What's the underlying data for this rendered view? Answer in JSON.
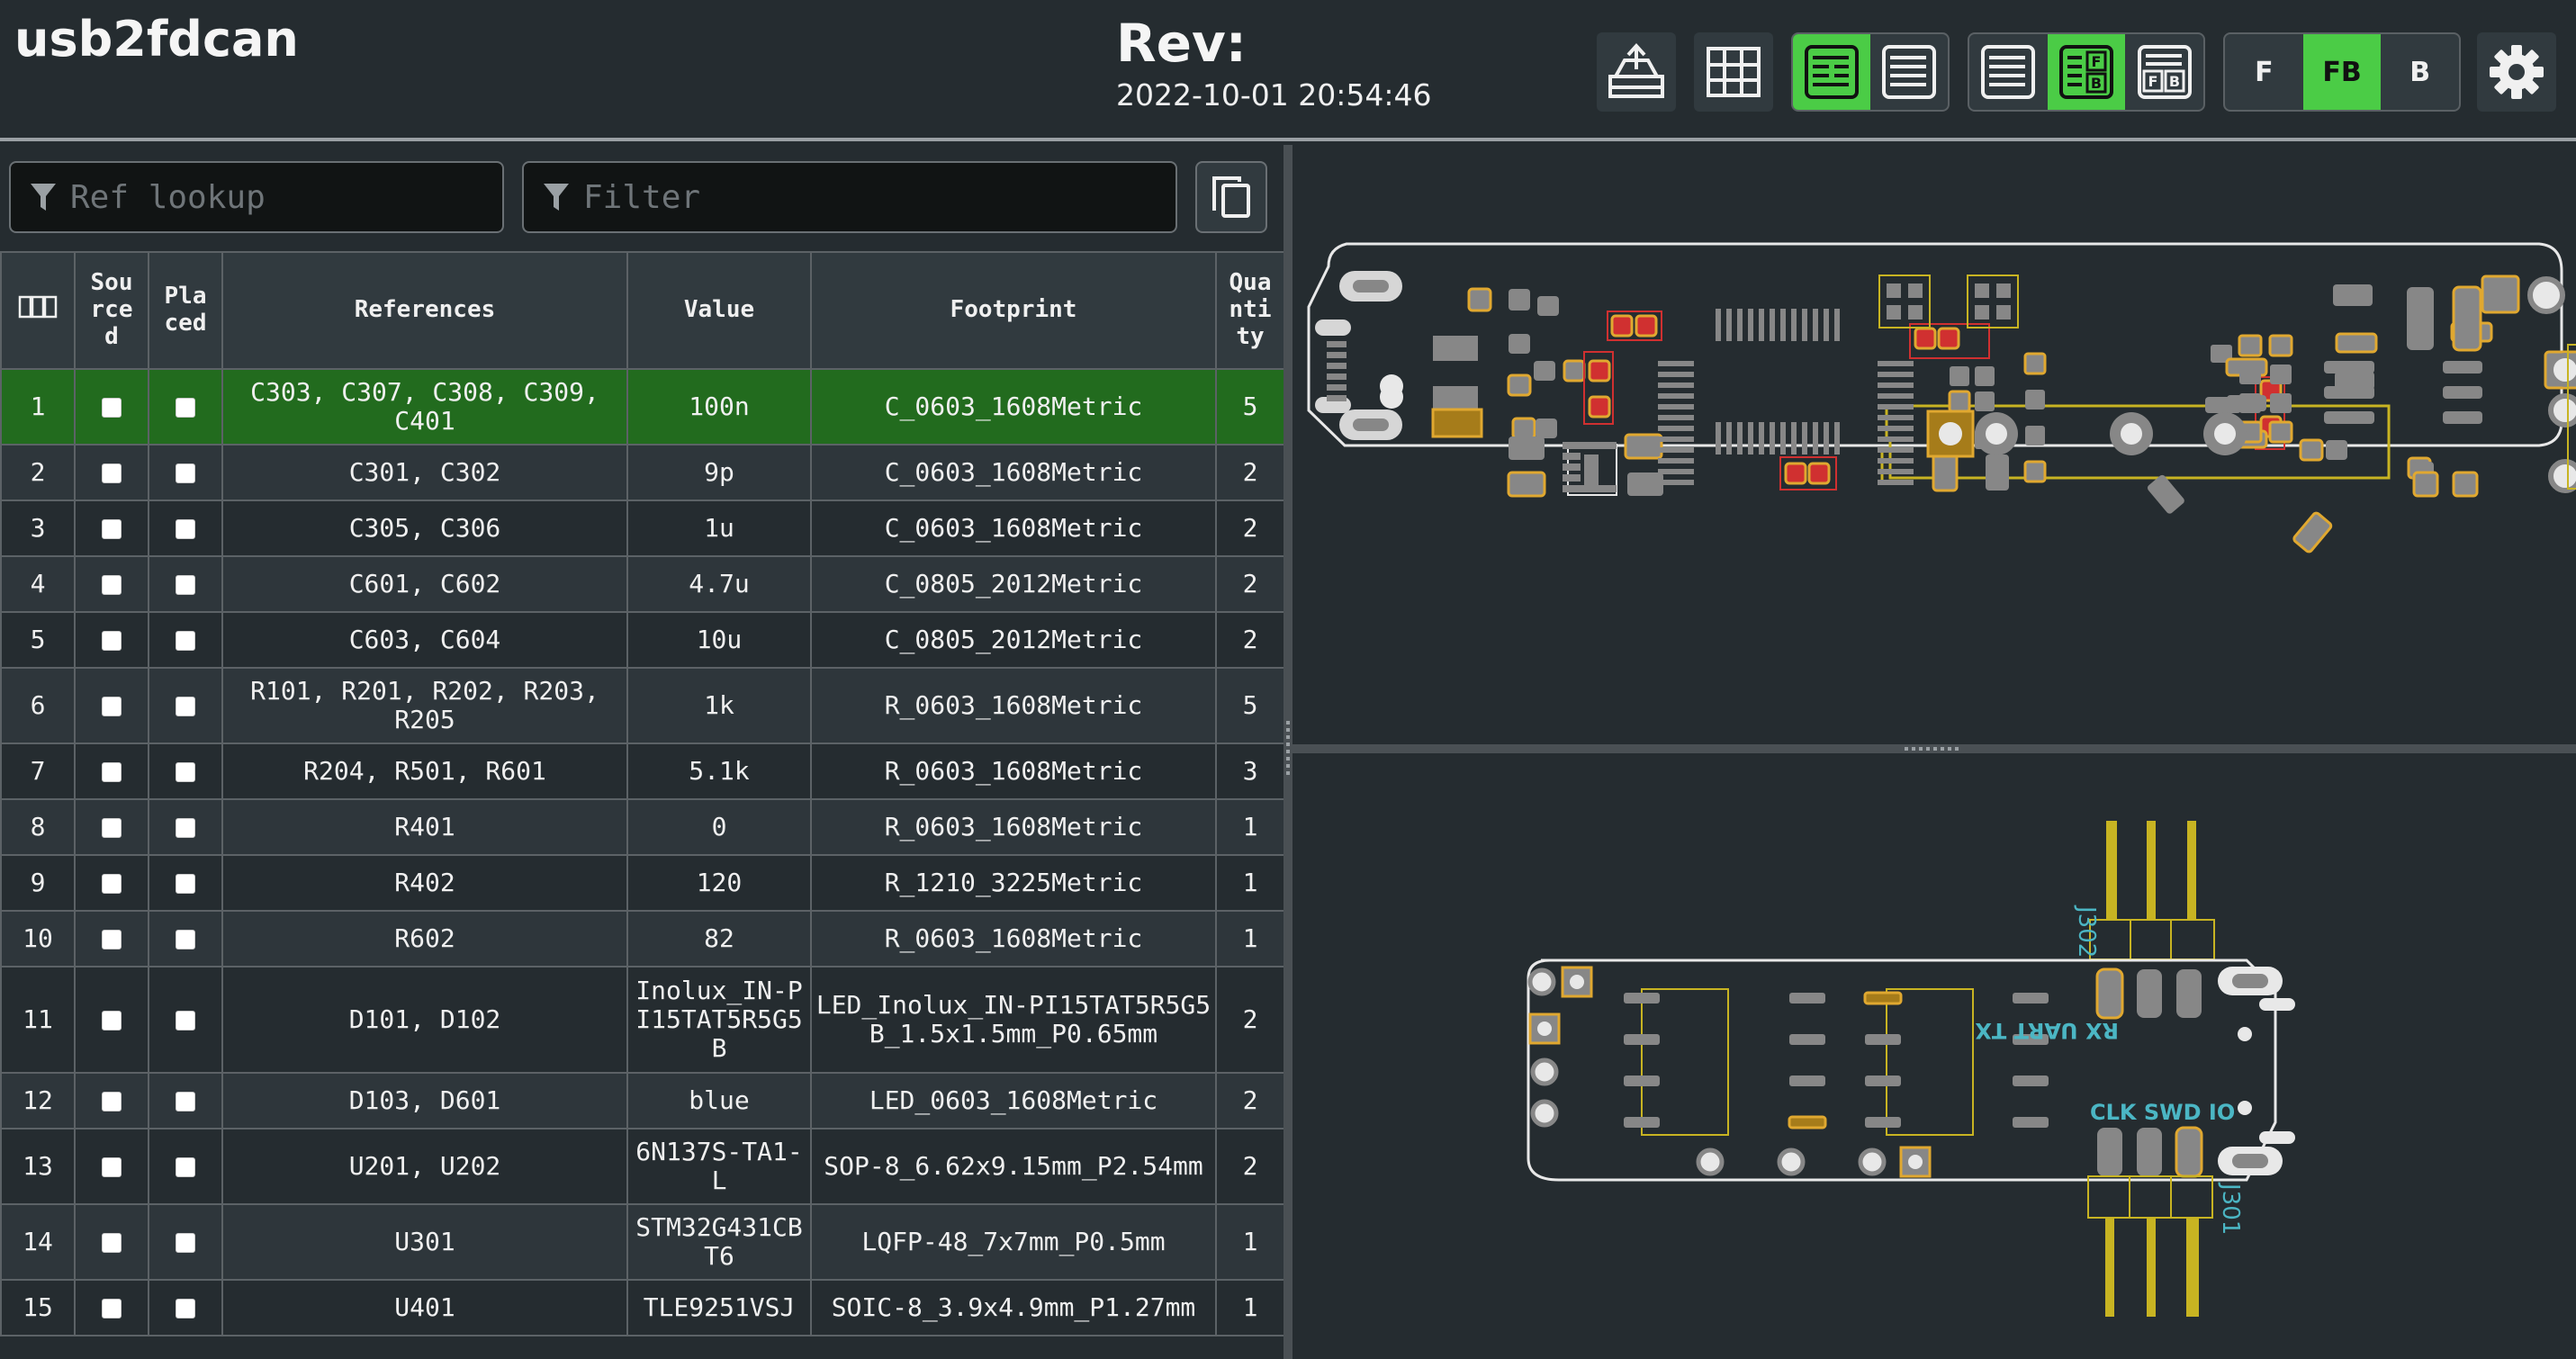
{
  "app": {
    "title": "usb2fdcan",
    "rev_label": "Rev:",
    "rev_date": "2022-10-01 20:54:46"
  },
  "toolbar": {
    "buttons": [
      {
        "icon": "import-bom-icon"
      },
      {
        "icon": "grid-icon"
      }
    ],
    "layout_group": [
      {
        "icon": "bom-left-layout-icon",
        "active": true
      },
      {
        "icon": "bom-top-layout-icon",
        "active": false
      }
    ],
    "bom_group": [
      {
        "icon": "bom-only-icon",
        "active": false
      },
      {
        "icon": "bom-left-right-icon",
        "active": true
      },
      {
        "icon": "bom-top-bottom-icon",
        "active": false
      }
    ],
    "side_group": [
      {
        "label": "F",
        "active": false
      },
      {
        "label": "FB",
        "active": true
      },
      {
        "label": "B",
        "active": false
      }
    ],
    "settings_icon": "gear-icon",
    "accent_color": "#4bcc46"
  },
  "filters": {
    "ref_lookup_placeholder": "Ref lookup",
    "filter_placeholder": "Filter"
  },
  "table": {
    "headers": {
      "index_icon": "checkbox-columns-icon",
      "sourced": "Sou rce d",
      "placed": "Pla ced",
      "references": "References",
      "value": "Value",
      "footprint": "Footprint",
      "quantity": "Qua nti ty"
    },
    "rows": [
      {
        "n": "1",
        "refs": "C303, C307, C308, C309, C401",
        "value": "100n",
        "footprint": "C_0603_1608Metric",
        "qty": "5",
        "selected": true
      },
      {
        "n": "2",
        "refs": "C301, C302",
        "value": "9p",
        "footprint": "C_0603_1608Metric",
        "qty": "2"
      },
      {
        "n": "3",
        "refs": "C305, C306",
        "value": "1u",
        "footprint": "C_0603_1608Metric",
        "qty": "2"
      },
      {
        "n": "4",
        "refs": "C601, C602",
        "value": "4.7u",
        "footprint": "C_0805_2012Metric",
        "qty": "2"
      },
      {
        "n": "5",
        "refs": "C603, C604",
        "value": "10u",
        "footprint": "C_0805_2012Metric",
        "qty": "2"
      },
      {
        "n": "6",
        "refs": "R101, R201, R202, R203, R205",
        "value": "1k",
        "footprint": "R_0603_1608Metric",
        "qty": "5"
      },
      {
        "n": "7",
        "refs": "R204, R501, R601",
        "value": "5.1k",
        "footprint": "R_0603_1608Metric",
        "qty": "3"
      },
      {
        "n": "8",
        "refs": "R401",
        "value": "0",
        "footprint": "R_0603_1608Metric",
        "qty": "1"
      },
      {
        "n": "9",
        "refs": "R402",
        "value": "120",
        "footprint": "R_1210_3225Metric",
        "qty": "1"
      },
      {
        "n": "10",
        "refs": "R602",
        "value": "82",
        "footprint": "R_0603_1608Metric",
        "qty": "1"
      },
      {
        "n": "11",
        "refs": "D101, D102",
        "value": "Inolux_IN-PI15TAT5R5G5B",
        "footprint": "LED_Inolux_IN-PI15TAT5R5G5B_1.5x1.5mm_P0.65mm",
        "qty": "2"
      },
      {
        "n": "12",
        "refs": "D103, D601",
        "value": "blue",
        "footprint": "LED_0603_1608Metric",
        "qty": "2"
      },
      {
        "n": "13",
        "refs": "U201, U202",
        "value": "6N137S-TA1-L",
        "footprint": "SOP-8_6.62x9.15mm_P2.54mm",
        "qty": "2"
      },
      {
        "n": "14",
        "refs": "U301",
        "value": "STM32G431CBT6",
        "footprint": "LQFP-48_7x7mm_P0.5mm",
        "qty": "1"
      },
      {
        "n": "15",
        "refs": "U401",
        "value": "TLE9251VSJ",
        "footprint": "SOIC-8_3.9x4.9mm_P1.27mm",
        "qty": "1"
      }
    ]
  },
  "pcb": {
    "front_refs": {
      "j302": "J302"
    },
    "back_labels": {
      "j302": "J302",
      "j301": "J301",
      "uart": "RX UART TX",
      "swd": "CLK SWD IO"
    },
    "colors": {
      "pad": "#878787",
      "pad_highlight": "#d03030",
      "pad_outline": "#e0a830",
      "silk": "#c8b422",
      "edge": "#e8e8e8",
      "label": "#4bb6c4"
    }
  }
}
